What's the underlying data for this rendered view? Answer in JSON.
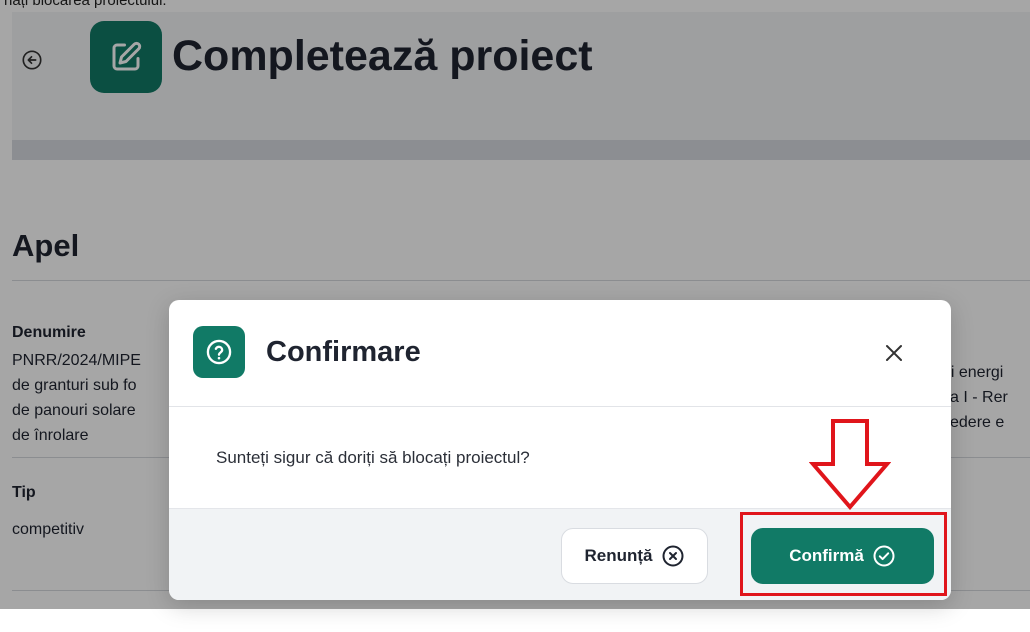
{
  "caption": "nați blocarea proiectului.",
  "header": {
    "title": "Completează proiect",
    "back_icon": "back-arrow-circle-icon",
    "title_icon": "edit-square-icon"
  },
  "section": {
    "title": "Apel"
  },
  "fields": {
    "denumire": {
      "label": "Denumire",
      "lines_left": [
        "PNRR/2024/MIPE",
        "de granturi sub fo",
        "de panouri solare",
        "de înrolare"
      ],
      "lines_right": [
        "rii energi",
        "xa I - Rer",
        "vedere e"
      ]
    },
    "tip": {
      "label": "Tip",
      "value": "competitiv"
    }
  },
  "modal": {
    "icon": "question-circle-icon",
    "title": "Confirmare",
    "close_icon": "close-icon",
    "message": "Sunteți sigur că doriți să blocați proiectul?",
    "cancel_label": "Renunță",
    "cancel_icon": "x-circle-icon",
    "confirm_label": "Confirmă",
    "confirm_icon": "check-circle-icon"
  },
  "colors": {
    "accent": "#117a66",
    "highlight": "#e0151b"
  }
}
